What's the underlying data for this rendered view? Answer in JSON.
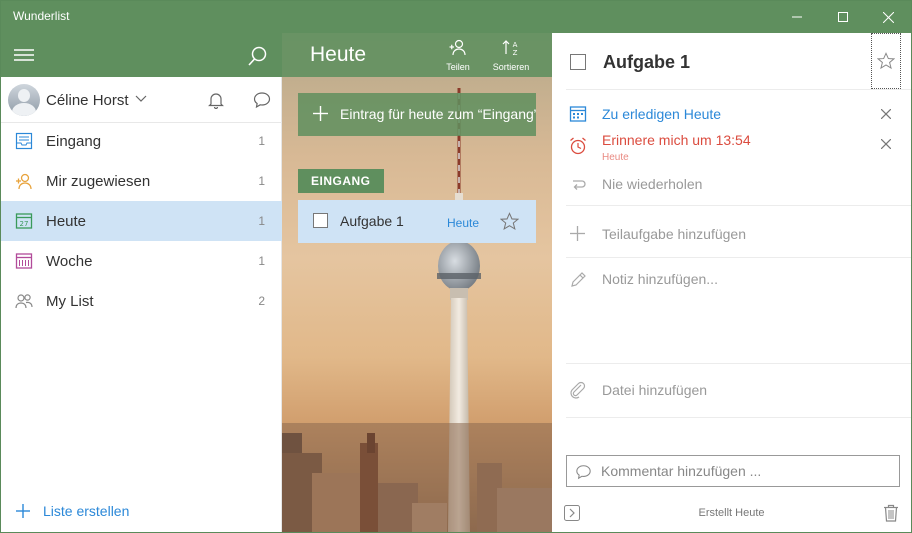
{
  "window": {
    "title": "Wunderlist"
  },
  "sidebar": {
    "user": {
      "name": "Céline Horst"
    },
    "items": [
      {
        "label": "Eingang",
        "count": "1",
        "icon": "inbox-icon"
      },
      {
        "label": "Mir zugewiesen",
        "count": "1",
        "icon": "assigned-user-icon"
      },
      {
        "label": "Heute",
        "count": "1",
        "icon": "calendar-today-icon",
        "active": true
      },
      {
        "label": "Woche",
        "count": "1",
        "icon": "calendar-week-icon"
      },
      {
        "label": "My List",
        "count": "2",
        "icon": "shared-list-icon"
      }
    ],
    "create_list_label": "Liste erstellen"
  },
  "middle": {
    "title": "Heute",
    "share_label": "Teilen",
    "sort_label": "Sortieren",
    "add_placeholder": "Eintrag für heute zum “Eingang” hinzufügen...",
    "section_label": "EINGANG",
    "task": {
      "title": "Aufgabe 1",
      "due": "Heute"
    }
  },
  "detail": {
    "title": "Aufgabe 1",
    "due_label": "Zu erledigen Heute",
    "reminder_label": "Erinnere mich um 13:54",
    "reminder_sub": "Heute",
    "repeat_label": "Nie wiederholen",
    "subtask_label": "Teilaufgabe hinzufügen",
    "note_label": "Notiz hinzufügen...",
    "file_label": "Datei hinzufügen",
    "comment_placeholder": "Kommentar hinzufügen ...",
    "created_label": "Erstellt Heute"
  },
  "colors": {
    "accent_green": "#5f8f5e",
    "blue": "#2b88d8",
    "red": "#db4c3f",
    "active_bg": "#cfe3f5"
  }
}
